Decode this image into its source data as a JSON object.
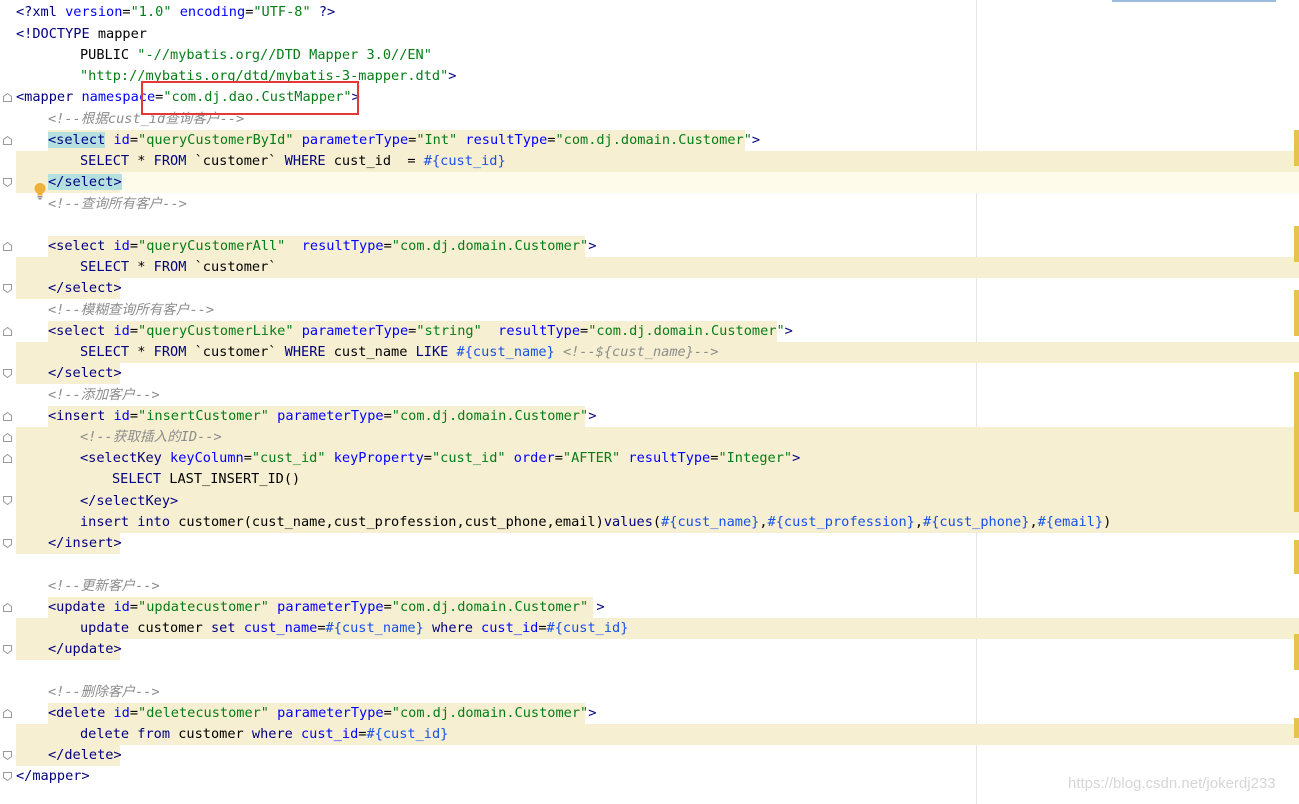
{
  "editor": {
    "file_type": "xml",
    "lines": {
      "l1_decl": "<?xml version=\"1.0\" encoding=\"UTF-8\" ?>",
      "l2_doctype": "<!DOCTYPE mapper",
      "l3_public": "PUBLIC \"-//mybatis.org//DTD Mapper 3.0//EN\"",
      "l4_dtd": "\"http://mybatis.org/dtd/mybatis-3-mapper.dtd\">",
      "l5_mapper_open": "<mapper namespace=\"com.dj.dao.CustMapper\">",
      "l6_comment": "<!--根据cust_id查询客户-->",
      "l7_select_open": "<select id=\"queryCustomerById\" parameterType=\"Int\" resultType=\"com.dj.domain.Customer\">",
      "l8_sql": "SELECT * FROM `customer` WHERE cust_id  = #{cust_id}",
      "l9_select_close": "</select>",
      "l10_comment": "<!--查询所有客户-->",
      "l12_select_open": "<select id=\"queryCustomerAll\"  resultType=\"com.dj.domain.Customer\">",
      "l13_sql": "SELECT * FROM `customer`",
      "l14_select_close": "</select>",
      "l15_comment": "<!--模糊查询所有客户-->",
      "l16_select_open": "<select id=\"queryCustomerLike\" parameterType=\"string\"  resultType=\"com.dj.domain.Customer\">",
      "l17_sql": "SELECT * FROM `customer` WHERE cust_name LIKE #{cust_name} <!--${cust_name}-->",
      "l18_select_close": "</select>",
      "l19_comment": "<!--添加客户-->",
      "l20_insert_open": "<insert id=\"insertCustomer\" parameterType=\"com.dj.domain.Customer\">",
      "l21_comment": "<!--获取插入的ID-->",
      "l22_selectkey_open": "<selectKey keyColumn=\"cust_id\" keyProperty=\"cust_id\" order=\"AFTER\" resultType=\"Integer\">",
      "l23_sql": "SELECT LAST_INSERT_ID()",
      "l24_selectkey_close": "</selectKey>",
      "l25_sql": "insert into customer(cust_name,cust_profession,cust_phone,email)values(#{cust_name},#{cust_profession},#{cust_phone},#{email})",
      "l26_insert_close": "</insert>",
      "l28_comment": "<!--更新客户-->",
      "l29_update_open": "<update id=\"updatecustomer\" parameterType=\"com.dj.domain.Customer\" >",
      "l30_sql": "update customer set cust_name=#{cust_name} where cust_id=#{cust_id}",
      "l31_update_close": "</update>",
      "l33_comment": "<!--删除客户-->",
      "l34_delete_open": "<delete id=\"deletecustomer\" parameterType=\"com.dj.domain.Customer\">",
      "l35_sql": "delete from customer where cust_id=#{cust_id}",
      "l36_delete_close": "</delete>",
      "l37_mapper_close": "</mapper>"
    }
  },
  "watermark": "https://blog.csdn.net/jokerdj233",
  "colors": {
    "sql_injection_bg": "#f7efd2",
    "tag": "#000080",
    "attribute": "#0000ff",
    "string": "#067d17",
    "comment": "#8c8c8c",
    "highlight_box": "#e53935",
    "marker": "#e6c34a"
  },
  "icons": [
    "intention-bulb-icon",
    "fold-icon"
  ]
}
